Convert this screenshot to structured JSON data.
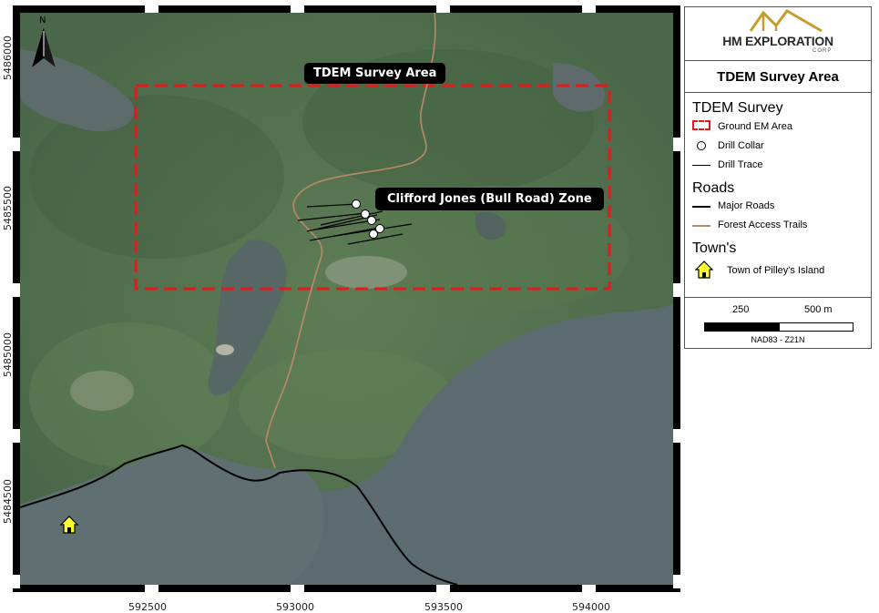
{
  "map": {
    "labels": {
      "survey_area": "TDEM Survey Area",
      "zone": "Clifford Jones (Bull Road) Zone"
    },
    "north_arrow_letter": "N",
    "x_ticks": [
      "592500",
      "593000",
      "593500",
      "594000"
    ],
    "y_ticks": [
      "5486000",
      "5485500",
      "5485000",
      "5484500"
    ],
    "colors": {
      "survey_outline": "#e31a1c",
      "trail": "#b98a6a",
      "major_road": "#000000",
      "town_icon": "#ffff33",
      "collar": "#ffffff"
    }
  },
  "legend": {
    "logo_main": "HM EXPLORATION",
    "logo_sub": "CORP",
    "title": "TDEM Survey Area",
    "sections": {
      "survey": "TDEM Survey",
      "roads": "Roads",
      "towns": "Town's"
    },
    "items": {
      "ground_em": "Ground EM Area",
      "drill_collar": "Drill Collar",
      "drill_trace": "Drill Trace",
      "major_roads": "Major Roads",
      "forest_trails": "Forest Access Trails",
      "town": "Town of Pilley's Island"
    },
    "scale": {
      "label_250": "250",
      "label_500": "500 m",
      "crs": "NAD83 - Z21N"
    }
  }
}
